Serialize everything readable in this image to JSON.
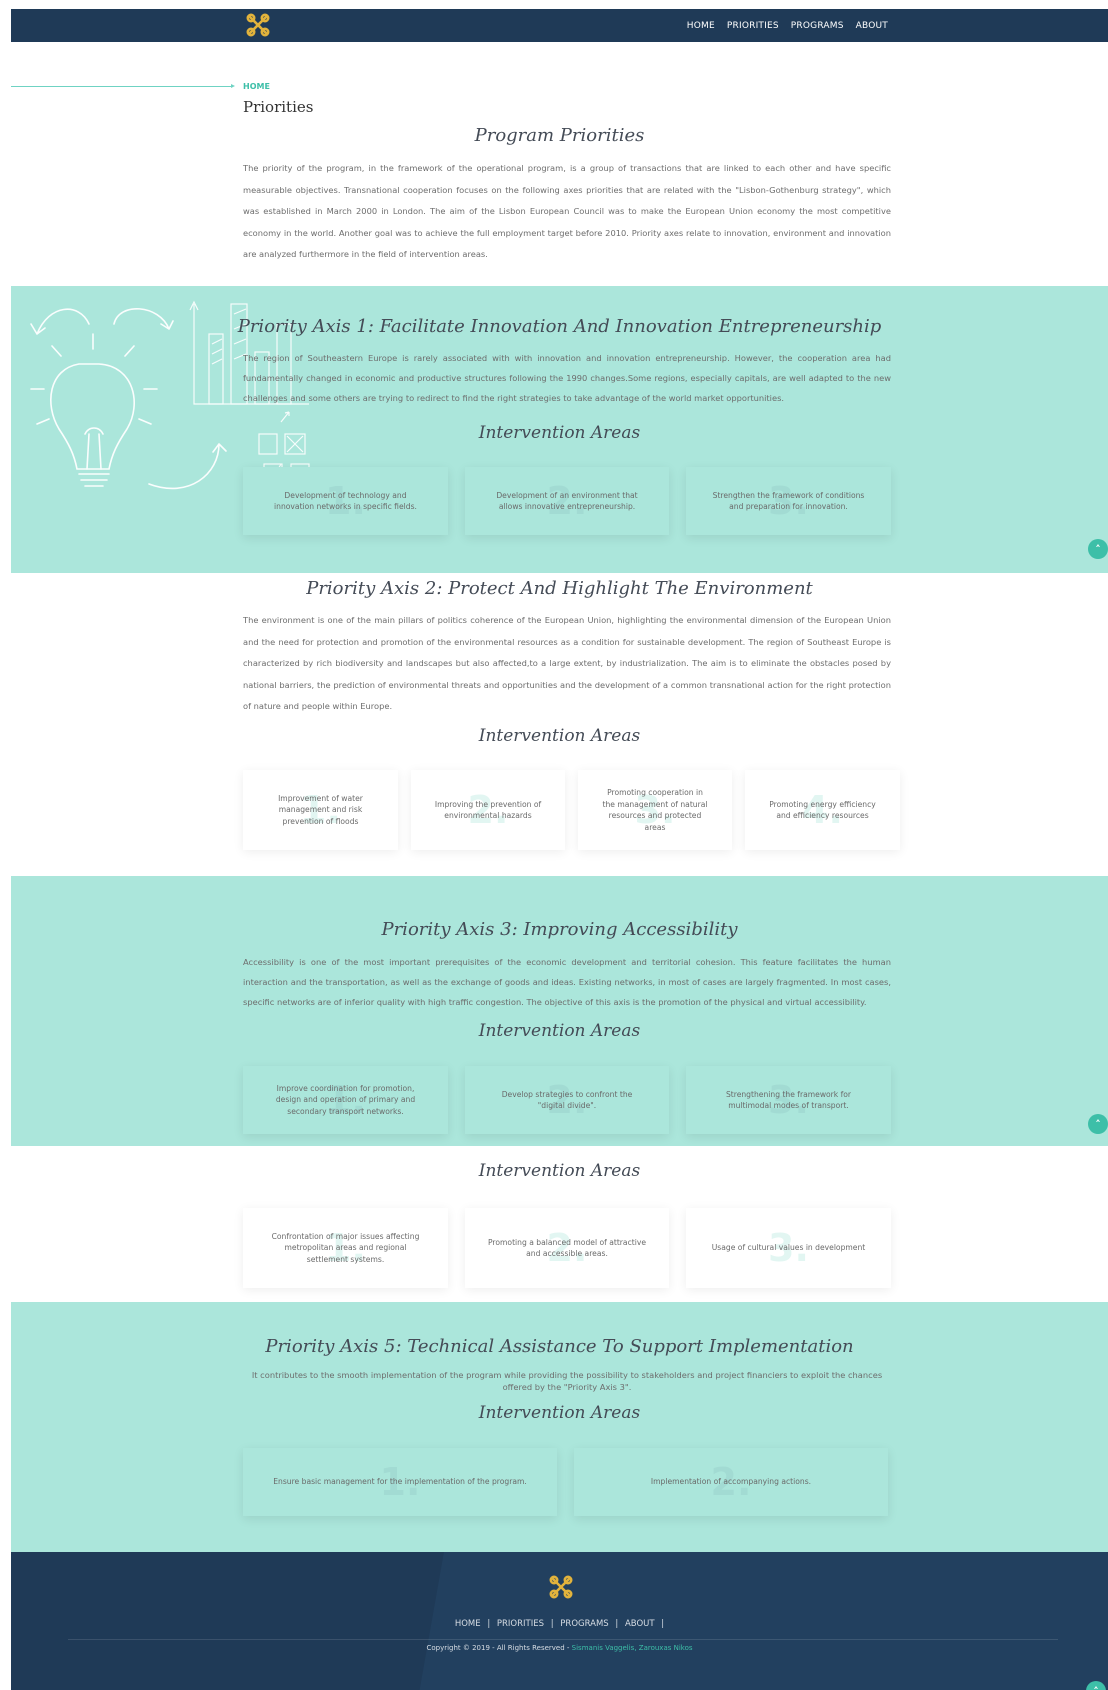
{
  "header": {
    "nav": [
      "HOME",
      "PRIORITIES",
      "PROGRAMS",
      "ABOUT"
    ]
  },
  "breadcrumb": {
    "home": "HOME",
    "title": "Priorities"
  },
  "intro": {
    "title": "Program Priorities",
    "text": "The priority of the program, in the framework of the operational program, is a group of transactions that are linked to each other and have specific measurable objectives. Transnational cooperation focuses on the following axes priorities that are related with the \"Lisbon-Gothenburg strategy\", which was established in March 2000 in London. The aim of the Lisbon European Council was to make the European Union economy the most competitive economy in the world. Another goal was to achieve the full employment target before 2010. Priority axes relate to innovation, environment and innovation are analyzed furthermore in the field of intervention areas."
  },
  "intervention_label": "Intervention Areas",
  "axis1": {
    "title": "Priority Axis 1: Facilitate Innovation And Innovation Entrepreneurship",
    "text": "The region of Southeastern Europe is rarely associated with with innovation and innovation entrepreneurship. However, the cooperation area had fundamentally changed in economic and productive structures following the 1990 changes.Some regions, especially capitals, are well adapted to the new challenges and some others are trying to redirect to find the right strategies to take advantage of the world market opportunities.",
    "areas": [
      {
        "num": "1.",
        "text": "Development of technology and innovation networks in specific fields."
      },
      {
        "num": "2.",
        "text": "Development of an environment that allows innovative entrepreneurship."
      },
      {
        "num": "3.",
        "text": "Strengthen the framework of conditions and preparation for innovation."
      }
    ]
  },
  "axis2": {
    "title": "Priority Axis 2: Protect And Highlight The Environment",
    "text": "The environment is one of the main pillars of politics coherence of the European Union, highlighting the environmental dimension of the European Union and the need for protection and promotion of the environmental resources as a condition for sustainable development. The region of Southeast Europe is characterized by rich biodiversity and landscapes but also affected,to a large extent, by industrialization. The aim is to eliminate the obstacles posed by national barriers, the prediction of environmental threats and opportunities and the development of a common transnational action for the right protection of nature and people within Europe.",
    "areas": [
      {
        "num": "1.",
        "text": "Improvement of water management and risk prevention of floods"
      },
      {
        "num": "2.",
        "text": "Improving the prevention of environmental hazards"
      },
      {
        "num": "3.",
        "text": "Promoting cooperation in the management of natural resources and protected areas"
      },
      {
        "num": "4.",
        "text": "Promoting energy efficiency and efficiency resources"
      }
    ]
  },
  "axis3": {
    "title": "Priority Axis 3: Improving Accessibility",
    "text": "Accessibility is one of the most important prerequisites of the economic development and territorial cohesion. This feature facilitates the human interaction and the transportation, as well as the exchange of goods and ideas. Existing networks, in most of cases are largely fragmented. In most cases, specific networks are of inferior quality with high traffic congestion. The objective of this axis is the promotion of the physical and virtual accessibility.",
    "areas": [
      {
        "num": "1.",
        "text": "Improve coordination for promotion, design and operation of primary and secondary transport networks."
      },
      {
        "num": "2.",
        "text": "Develop strategies to confront the \"digital divide\"."
      },
      {
        "num": "3.",
        "text": "Strengthening the framework for multimodal modes of transport."
      }
    ]
  },
  "axis4": {
    "areas": [
      {
        "num": "1.",
        "text": "Confrontation of major issues affecting metropolitan areas and regional settlement systems."
      },
      {
        "num": "2.",
        "text": "Promoting a balanced model of attractive and accessible areas."
      },
      {
        "num": "3.",
        "text": "Usage of cultural values in development"
      }
    ]
  },
  "axis5": {
    "title": "Priority Axis 5: Technical Assistance To Support Implementation",
    "text": "It contributes to the smooth implementation of the program while providing the possibility to stakeholders and project financiers to exploit the chances offered by the \"Priority Axis 3\".",
    "areas": [
      {
        "num": "1.",
        "text": "Ensure basic management for the implementation of the program."
      },
      {
        "num": "2.",
        "text": "Implementation of accompanying actions."
      }
    ]
  },
  "footer": {
    "nav": [
      "HOME",
      "PRIORITIES",
      "PROGRAMS",
      "ABOUT"
    ],
    "separator": "|",
    "copyright": "Copyright © 2019 - All Rights Reserved - ",
    "authors": "Sismanis Vaggelis, Zarouxas Nikos"
  },
  "colors": {
    "navy": "#1f3a57",
    "mint": "#abe6db",
    "accent": "#3dbfa8",
    "logo_gold": "#e2b33c"
  },
  "icons": [
    "logo-icon",
    "chevron-up-icon",
    "lightbulb-illustration"
  ]
}
